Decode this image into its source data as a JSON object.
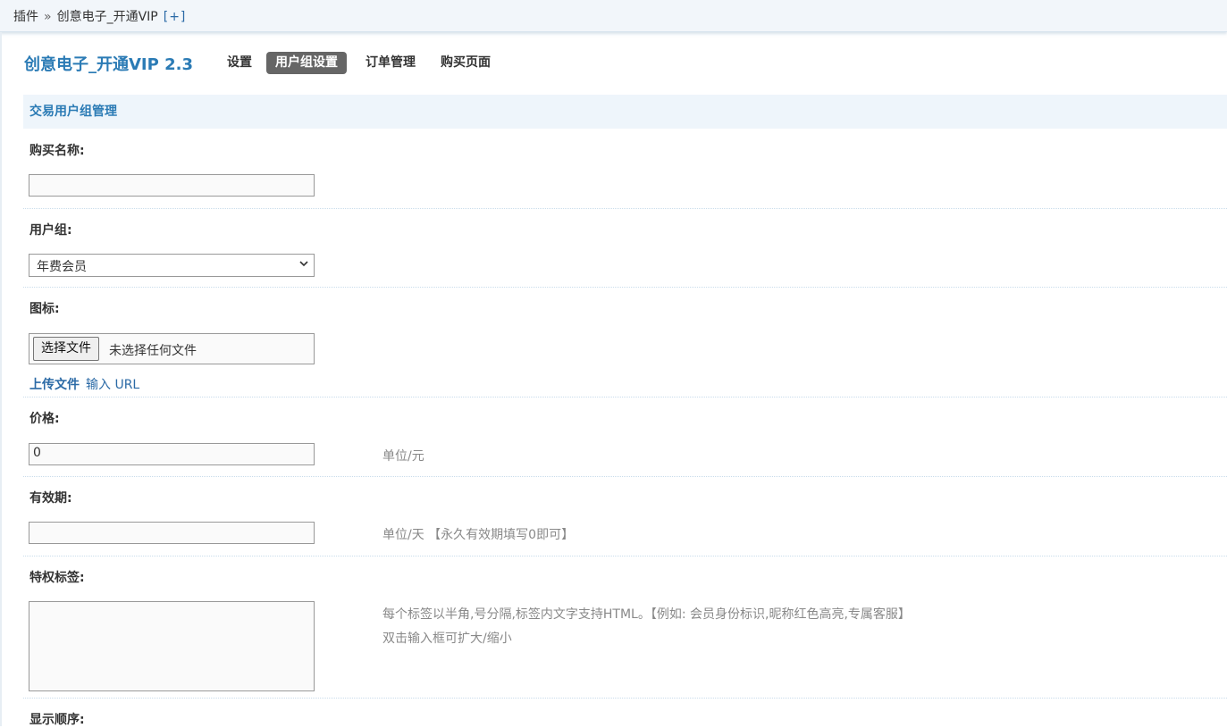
{
  "breadcrumb": {
    "root": "插件",
    "separator": "»",
    "current": "创意电子_开通VIP",
    "add": "[+]"
  },
  "plugin": {
    "title": "创意电子_开通VIP 2.3"
  },
  "nav": [
    {
      "label": "设置"
    },
    {
      "label": "用户组设置",
      "active": true
    },
    {
      "label": "订单管理"
    },
    {
      "label": "购买页面"
    }
  ],
  "section": {
    "title": "交易用户组管理"
  },
  "form": {
    "name": {
      "label": "购买名称:",
      "value": ""
    },
    "group": {
      "label": "用户组:",
      "selected": "年费会员"
    },
    "icon": {
      "label": "图标:",
      "button": "选择文件",
      "status": "未选择任何文件",
      "upload_link": "上传文件",
      "url_link": "输入 URL"
    },
    "price": {
      "label": "价格:",
      "value": "0",
      "tip": "单位/元"
    },
    "validity": {
      "label": "有效期:",
      "value": "",
      "tip": "单位/天 【永久有效期填写0即可】"
    },
    "tags": {
      "label": "特权标签:",
      "value": "",
      "tip1": "每个标签以半角,号分隔,标签内文字支持HTML。【例如: 会员身份标识,昵称红色高亮,专属客服】",
      "tip2": "双击输入框可扩大/缩小"
    },
    "order": {
      "label": "显示顺序:"
    }
  },
  "colors": {
    "accent": "#2b7bb5",
    "active_tab": "#666666",
    "section_bg": "#eef5fb"
  }
}
